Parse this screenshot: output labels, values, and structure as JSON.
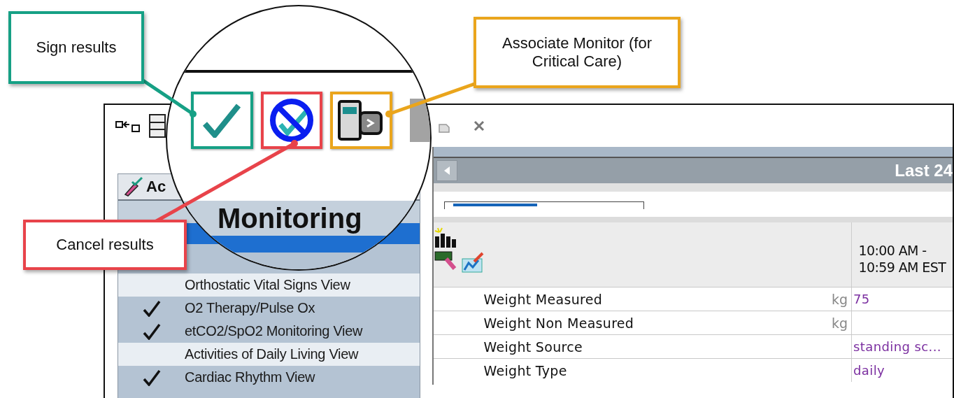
{
  "callouts": [
    {
      "text": "Sign results",
      "color": "#16a085"
    },
    {
      "text": "Cancel results",
      "color": "#e8434a"
    },
    {
      "text": "Associate Monitor (for Critical Care)",
      "color": "#eaa51c"
    }
  ],
  "magnifier": {
    "heading": "Monitoring",
    "tools": [
      {
        "kind": "sign",
        "color": "#16a085"
      },
      {
        "kind": "cancel",
        "color": "#e8434a"
      },
      {
        "kind": "monitor",
        "color": "#eaa51c"
      }
    ]
  },
  "left_panel": {
    "title": "Ac",
    "views": [
      {
        "label": "Orthostatic Vital Signs View",
        "checked": false
      },
      {
        "label": "O2 Therapy/Pulse Ox",
        "checked": true
      },
      {
        "label": "etCO2/SpO2 Monitoring View",
        "checked": true
      },
      {
        "label": "Activities of Daily Living View",
        "checked": false
      },
      {
        "label": "Cardiac Rhythm View",
        "checked": true
      }
    ]
  },
  "results": {
    "range_label": "Last 24",
    "column_header": "10:00 AM -\n10:59 AM EST",
    "rows": [
      {
        "label": "Weight Measured",
        "unit": "kg",
        "value": "75"
      },
      {
        "label": "Weight Non Measured",
        "unit": "kg"
      },
      {
        "label": "Weight Source",
        "value": "standing sc..."
      },
      {
        "label": "Weight Type",
        "value": "daily"
      }
    ]
  }
}
